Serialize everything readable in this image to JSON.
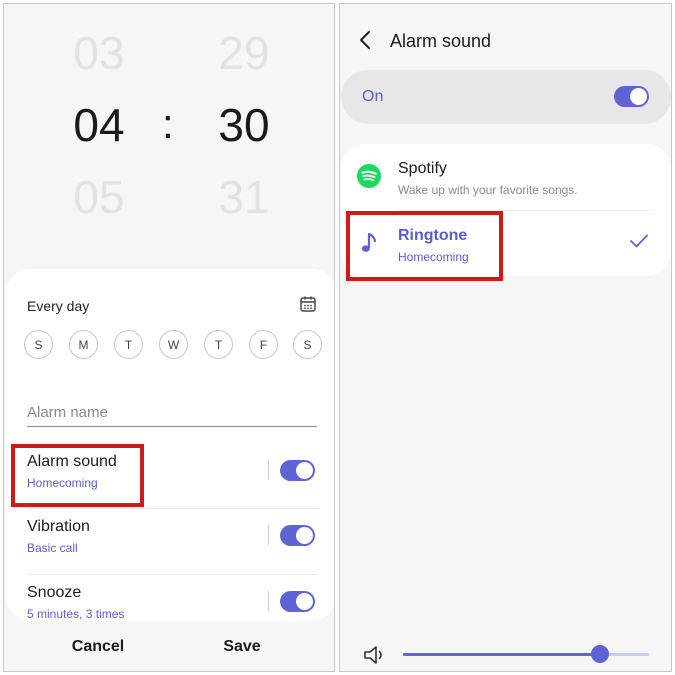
{
  "time_picker": {
    "hour_prev": "03",
    "hour": "04",
    "hour_next": "05",
    "separator": ":",
    "minute_prev": "29",
    "minute": "30",
    "minute_next": "31"
  },
  "alarm_settings": {
    "repeat_label": "Every day",
    "days": [
      "S",
      "M",
      "T",
      "W",
      "T",
      "F",
      "S"
    ],
    "alarm_name_placeholder": "Alarm name",
    "options": [
      {
        "title": "Alarm sound",
        "subtitle": "Homecoming",
        "enabled": true
      },
      {
        "title": "Vibration",
        "subtitle": "Basic call",
        "enabled": true
      },
      {
        "title": "Snooze",
        "subtitle": "5 minutes, 3 times",
        "enabled": true
      }
    ],
    "cancel_label": "Cancel",
    "save_label": "Save"
  },
  "alarm_sound_screen": {
    "title": "Alarm sound",
    "master_label": "On",
    "master_enabled": true,
    "sources": [
      {
        "title": "Spotify",
        "subtitle": "Wake up with your favorite songs.",
        "icon": "spotify-icon",
        "selected": false
      },
      {
        "title": "Ringtone",
        "subtitle": "Homecoming",
        "icon": "music-note-icon",
        "selected": true
      }
    ],
    "volume_level": 0.8
  },
  "colors": {
    "accent": "#5f63d6",
    "highlight_box": "#d0191b",
    "spotify_green": "#1ed760"
  }
}
